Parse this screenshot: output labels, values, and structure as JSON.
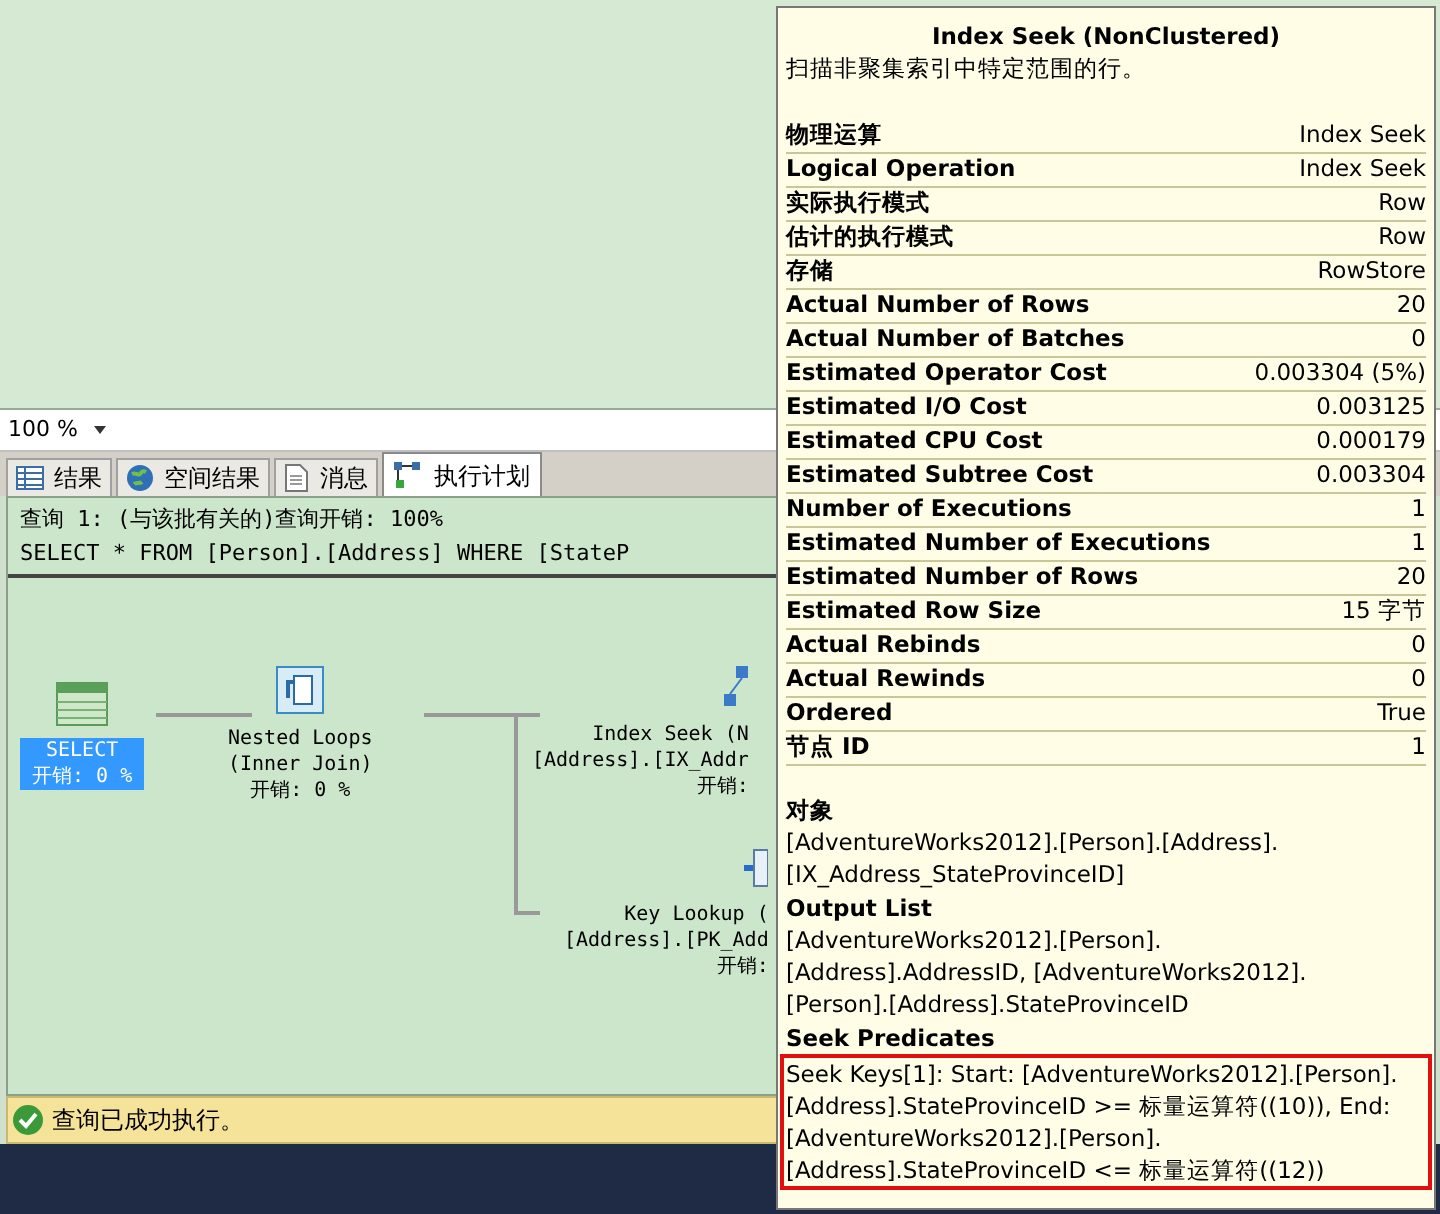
{
  "zoom": {
    "value": "100 %"
  },
  "tabs": [
    {
      "label": "结果",
      "kind": "table",
      "selected": false
    },
    {
      "label": "空间结果",
      "kind": "globe",
      "selected": false
    },
    {
      "label": "消息",
      "kind": "doc",
      "selected": false
    },
    {
      "label": "执行计划",
      "kind": "plan",
      "selected": true
    }
  ],
  "plan_header": [
    "查询 1: (与该批有关的)查询开销: 100%",
    "SELECT * FROM [Person].[Address] WHERE [StateP"
  ],
  "plan_nodes": [
    {
      "kind": "select",
      "lines": [
        "SELECT",
        "开销: 0 %"
      ],
      "selected": true
    },
    {
      "kind": "loops",
      "lines": [
        "Nested Loops",
        "(Inner Join)",
        "开销: 0 %"
      ],
      "selected": false
    },
    {
      "kind": "seek",
      "lines": [
        "Index Seek (N",
        "[Address].[IX_Addr",
        "开销:"
      ],
      "selected": false
    },
    {
      "kind": "lookup",
      "lines": [
        "Key Lookup (",
        "[Address].[PK_Add",
        "开销:"
      ],
      "selected": false
    }
  ],
  "status_bar": {
    "text": "查询已成功执行。"
  },
  "tooltip": {
    "title": "Index Seek (NonClustered)",
    "description": "扫描非聚集索引中特定范围的行。",
    "properties": [
      {
        "label": "物理运算",
        "value": "Index Seek"
      },
      {
        "label": "Logical Operation",
        "value": "Index Seek"
      },
      {
        "label": "实际执行模式",
        "value": "Row"
      },
      {
        "label": "估计的执行模式",
        "value": "Row"
      },
      {
        "label": "存储",
        "value": "RowStore"
      },
      {
        "label": "Actual Number of Rows",
        "value": "20"
      },
      {
        "label": "Actual Number of Batches",
        "value": "0"
      },
      {
        "label": "Estimated Operator Cost",
        "value": "0.003304 (5%)"
      },
      {
        "label": "Estimated I/O Cost",
        "value": "0.003125"
      },
      {
        "label": "Estimated CPU Cost",
        "value": "0.000179"
      },
      {
        "label": "Estimated Subtree Cost",
        "value": "0.003304"
      },
      {
        "label": "Number of Executions",
        "value": "1"
      },
      {
        "label": "Estimated Number of Executions",
        "value": "1"
      },
      {
        "label": "Estimated Number of Rows",
        "value": "20"
      },
      {
        "label": "Estimated Row Size",
        "value": "15 字节"
      },
      {
        "label": "Actual Rebinds",
        "value": "0"
      },
      {
        "label": "Actual Rewinds",
        "value": "0"
      },
      {
        "label": "Ordered",
        "value": "True"
      },
      {
        "label": "节点 ID",
        "value": "1"
      }
    ],
    "sections": [
      {
        "heading": "对象",
        "highlighted": false,
        "lines": [
          "[AdventureWorks2012].[Person].[Address].",
          "[IX_Address_StateProvinceID]"
        ]
      },
      {
        "heading": "Output List",
        "highlighted": false,
        "lines": [
          "[AdventureWorks2012].[Person].",
          "[Address].AddressID, [AdventureWorks2012].",
          "[Person].[Address].StateProvinceID"
        ]
      },
      {
        "heading": "Seek Predicates",
        "highlighted": true,
        "lines": [
          "Seek Keys[1]: Start: [AdventureWorks2012].[Person].",
          "[Address].StateProvinceID  >= 标量运算符((10)), End:",
          "[AdventureWorks2012].[Person].",
          "[Address].StateProvinceID  <= 标量运算符((12))"
        ]
      }
    ]
  }
}
